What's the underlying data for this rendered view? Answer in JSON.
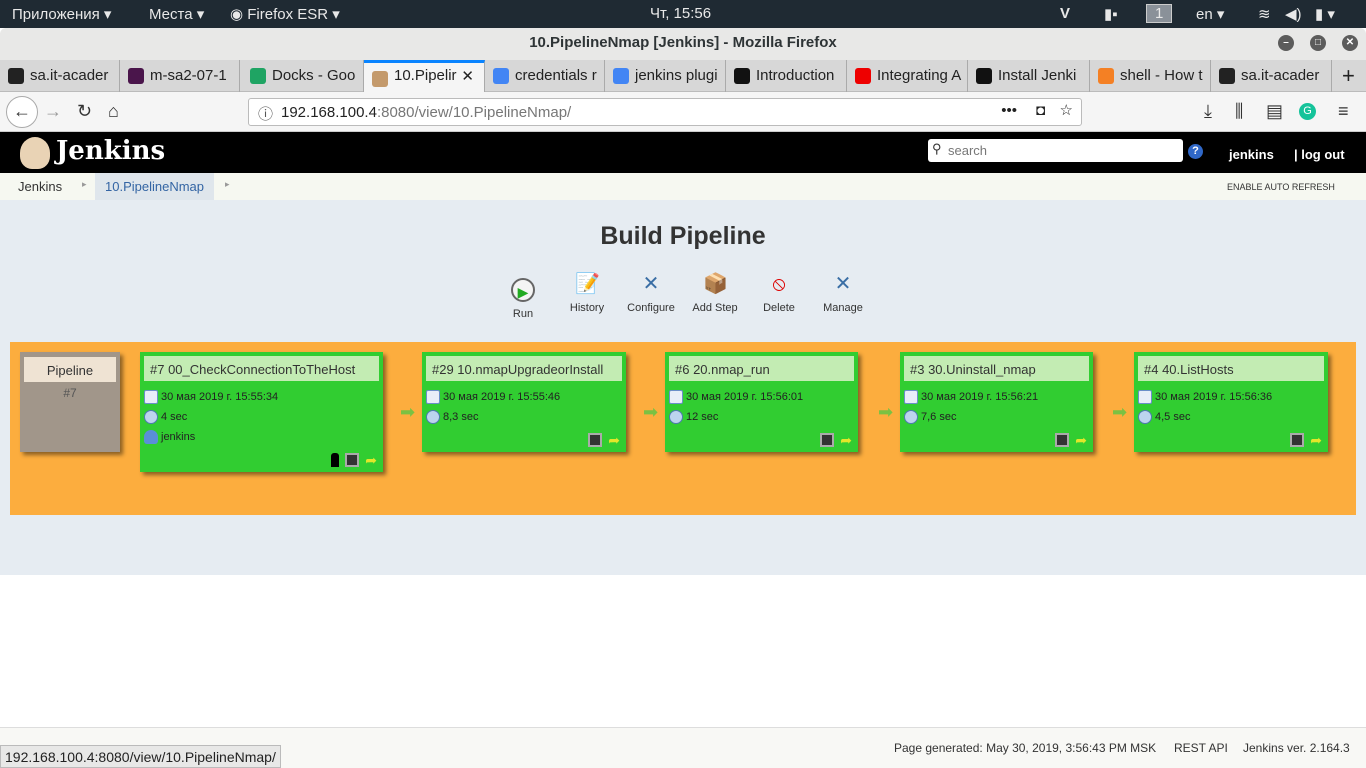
{
  "system": {
    "apps": "Приложения",
    "places": "Места",
    "browser": "Firefox ESR",
    "clock": "Чт, 15:56",
    "workspace": "1",
    "lang": "en"
  },
  "window": {
    "title": "10.PipelineNmap [Jenkins] - Mozilla Firefox"
  },
  "tabs": [
    {
      "label": "sa.it-acader",
      "icon": "github-icon",
      "color": "#222"
    },
    {
      "label": "m-sa2-07-1",
      "icon": "slack-icon",
      "color": "#4a154b"
    },
    {
      "label": "Docks - Goo",
      "icon": "google-drive-icon",
      "color": "#1fa463"
    },
    {
      "label": "10.Pipelir",
      "icon": "jenkins-icon",
      "color": "#c49a6c",
      "active": true
    },
    {
      "label": "credentials r",
      "icon": "google-icon",
      "color": "#4285f4"
    },
    {
      "label": "jenkins plugi",
      "icon": "google-icon",
      "color": "#4285f4"
    },
    {
      "label": "Introduction",
      "icon": "ansible-icon",
      "color": "#111"
    },
    {
      "label": "Integrating A",
      "icon": "redhat-icon",
      "color": "#e00"
    },
    {
      "label": "Install Jenki",
      "icon": "medium-icon",
      "color": "#111"
    },
    {
      "label": "shell - How t",
      "icon": "stackoverflow-icon",
      "color": "#f48024"
    },
    {
      "label": "sa.it-acader",
      "icon": "github-icon",
      "color": "#222"
    }
  ],
  "url": {
    "host": "192.168.100.4",
    "rest": ":8080/view/10.PipelineNmap/"
  },
  "jenkins": {
    "brand": "Jenkins",
    "search_placeholder": "search",
    "user": "jenkins",
    "logout": "| log out"
  },
  "breadcrumbs": [
    "Jenkins",
    "10.PipelineNmap"
  ],
  "auto_refresh": "ENABLE AUTO REFRESH",
  "page_title": "Build Pipeline",
  "toolbar": [
    "Run",
    "History",
    "Configure",
    "Add Step",
    "Delete",
    "Manage"
  ],
  "pipeline": {
    "label": "Pipeline",
    "number": "#7"
  },
  "stages": [
    {
      "title": "#7 00_CheckConnectionToTheHost",
      "date": "30 мая 2019 г. 15:55:34",
      "duration": "4 sec",
      "user": "jenkins"
    },
    {
      "title": "#29 10.nmapUpgradeorInstall",
      "date": "30 мая 2019 г. 15:55:46",
      "duration": "8,3 sec"
    },
    {
      "title": "#6 20.nmap_run",
      "date": "30 мая 2019 г. 15:56:01",
      "duration": "12 sec"
    },
    {
      "title": "#3 30.Uninstall_nmap",
      "date": "30 мая 2019 г. 15:56:21",
      "duration": "7,6 sec"
    },
    {
      "title": "#4 40.ListHosts",
      "date": "30 мая 2019 г. 15:56:36",
      "duration": "4,5 sec"
    }
  ],
  "colors": {
    "pipeline_bg": "#fcad3e",
    "stage_success": "#31cd31",
    "stage_header": "#c3ecb3"
  },
  "footer": {
    "generated": "Page generated: May 30, 2019, 3:56:43 PM MSK",
    "rest_api": "REST API",
    "version": "Jenkins ver. 2.164.3"
  },
  "status_url": "192.168.100.4:8080/view/10.PipelineNmap/"
}
